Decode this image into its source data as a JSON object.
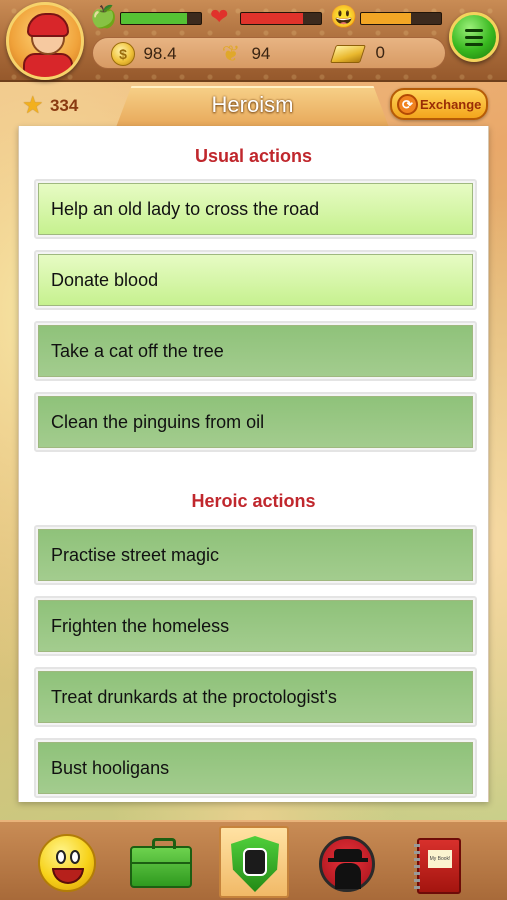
{
  "header": {
    "stats": [
      {
        "icon": "apple-icon",
        "level": 0.82,
        "color": "#55c234"
      },
      {
        "icon": "heart-icon",
        "level": 0.78,
        "color": "#e0322b"
      },
      {
        "icon": "smiley-icon",
        "level": 0.62,
        "color": "#f3a625"
      }
    ],
    "resources": {
      "coins": "98.4",
      "wheat": "94",
      "gold": "0"
    },
    "coin_symbol": "$"
  },
  "titlebar": {
    "stars": "334",
    "title": "Heroism",
    "exchange_label": "Exchange"
  },
  "sections": [
    {
      "title": "Usual actions",
      "actions": [
        "Help an old lady to cross the road",
        "Donate blood",
        "Take a cat off the tree",
        "Clean the pinguins from oil"
      ]
    },
    {
      "title": "Heroic actions",
      "actions": [
        "Practise street magic",
        "Frighten the homeless",
        "Treat drunkards at the proctologist's",
        "Bust hooligans"
      ]
    }
  ],
  "bottom_nav": {
    "items": [
      "mood-smiley-icon",
      "briefcase-icon",
      "heroism-shield-icon",
      "spy-icon",
      "notebook-icon"
    ],
    "notebook_text": "My Book!"
  },
  "colors": {
    "section_title": "#c0272d",
    "action_light": "#c6f18f",
    "action_dark": "#8fc27a"
  }
}
